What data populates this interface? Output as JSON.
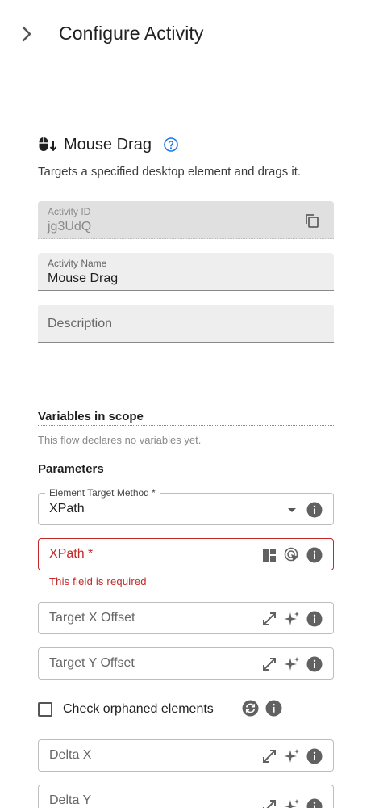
{
  "header": {
    "title": "Configure Activity",
    "back_icon": "chevron-right-icon"
  },
  "activity": {
    "icon": "mouse-drag-icon",
    "title": "Mouse Drag",
    "help_icon": "help-circle-icon",
    "description": "Targets a specified desktop element and drags it."
  },
  "fields": {
    "activity_id": {
      "label": "Activity ID",
      "value": "jg3UdQ",
      "icon": "copy-icon"
    },
    "activity_name": {
      "label": "Activity Name",
      "value": "Mouse Drag"
    },
    "description": {
      "placeholder": "Description"
    }
  },
  "variables": {
    "title": "Variables in scope",
    "empty_text": "This flow declares no variables yet."
  },
  "parameters": {
    "title": "Parameters",
    "target_method": {
      "label": "Element Target Method *",
      "value": "XPath"
    },
    "xpath": {
      "placeholder": "XPath *",
      "error": "This field is required"
    },
    "target_x_offset": {
      "placeholder": "Target X Offset"
    },
    "target_y_offset": {
      "placeholder": "Target Y Offset"
    },
    "check_orphaned": {
      "label": "Check orphaned elements",
      "checked": false
    },
    "delta_x": {
      "placeholder": "Delta X"
    },
    "delta_y": {
      "placeholder": "Delta Y"
    }
  },
  "colors": {
    "error": "#c62828",
    "accent_blue": "#1a73e8",
    "field_bg": "#eeeeee"
  }
}
